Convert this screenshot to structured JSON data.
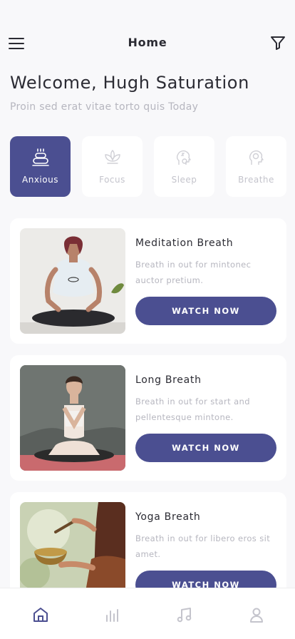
{
  "header": {
    "title": "Home",
    "menu_icon": "hamburger-menu-icon",
    "filter_icon": "filter-funnel-icon"
  },
  "welcome": {
    "title": "Welcome, Hugh Saturation",
    "subtitle": "Proin sed erat vitae torto quis Today"
  },
  "categories": [
    {
      "label": "Anxious",
      "icon": "anxious-icon",
      "active": true
    },
    {
      "label": "Focus",
      "icon": "lotus-icon",
      "active": false
    },
    {
      "label": "Sleep",
      "icon": "sleep-head-icon",
      "active": false
    },
    {
      "label": "Breathe",
      "icon": "breathe-head-icon",
      "active": false
    }
  ],
  "cards": [
    {
      "title": "Meditation Breath",
      "description": "Breath in out for mintonec auctor pretium.",
      "button": "WATCH NOW"
    },
    {
      "title": "Long Breath",
      "description": "Breath in out for start and pellentesque mintone.",
      "button": "WATCH NOW"
    },
    {
      "title": "Yoga Breath",
      "description": "Breath in out for libero eros sit amet.",
      "button": "WATCH NOW"
    }
  ],
  "bottom_nav": [
    {
      "icon": "home-icon",
      "active": true
    },
    {
      "icon": "stats-bars-icon",
      "active": false
    },
    {
      "icon": "music-note-icon",
      "active": false
    },
    {
      "icon": "profile-icon",
      "active": false
    }
  ],
  "colors": {
    "accent": "#4b4f91",
    "background": "#f8f8fa",
    "card": "#ffffff",
    "muted_text": "#b6b6bf"
  }
}
